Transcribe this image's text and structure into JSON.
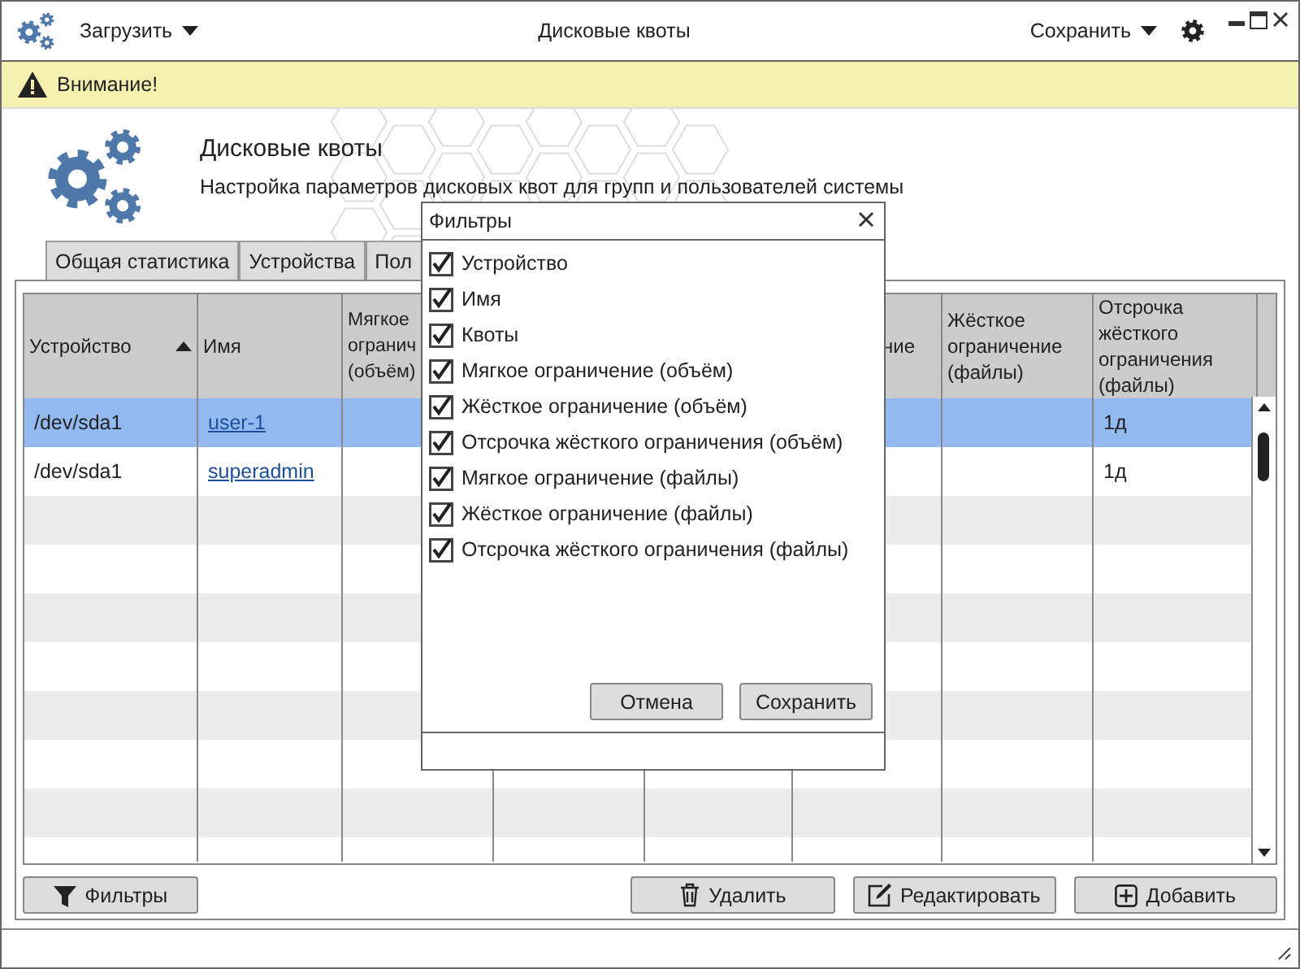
{
  "toolbar": {
    "load_menu": "Загрузить",
    "title": "Дисковые квоты",
    "save_menu": "Сохранить"
  },
  "warning": "Внимание!",
  "header": {
    "title": "Дисковые квоты",
    "subtitle": "Настройка параметров дисковых квот для групп и пользователей системы"
  },
  "tabs": [
    {
      "label": "Общая статистика",
      "selected": false
    },
    {
      "label": "Устройства",
      "selected": false
    },
    {
      "label": "Пол",
      "selected": false
    }
  ],
  "table": {
    "columns": [
      {
        "lines": [
          "Устройство"
        ],
        "sorted": true
      },
      {
        "lines": [
          "Имя"
        ]
      },
      {
        "lines": [
          "Мягкое",
          "огранич",
          "(объём)"
        ]
      },
      {
        "lines": [
          "ние"
        ]
      },
      {
        "lines": [
          "Жёсткое",
          "ограничение",
          "(файлы)"
        ]
      },
      {
        "lines": [
          "Отсрочка",
          "жёсткого",
          "ограничения",
          "(файлы)"
        ]
      }
    ],
    "rows": [
      {
        "device": "/dev/sda1",
        "name": "user-1",
        "grace_files": "1д",
        "selected": true
      },
      {
        "device": "/dev/sda1",
        "name": "superadmin",
        "grace_files": "1д",
        "selected": false
      }
    ]
  },
  "buttons": [
    {
      "label": "Фильтры",
      "kind": "filter"
    },
    {
      "label": "Удалить",
      "kind": "trash"
    },
    {
      "label": "Редактировать",
      "kind": "edit"
    },
    {
      "label": "Добавить",
      "kind": "add"
    }
  ],
  "dialog": {
    "title": "Фильтры",
    "options": [
      {
        "label": "Устройство",
        "checked": true
      },
      {
        "label": "Имя",
        "checked": true
      },
      {
        "label": "Квоты",
        "checked": true
      },
      {
        "label": "Мягкое ограничение (объём)",
        "checked": true
      },
      {
        "label": "Жёсткое ограничение (объём)",
        "checked": true
      },
      {
        "label": "Отсрочка жёсткого ограничения (объём)",
        "checked": true
      },
      {
        "label": "Мягкое ограничение (файлы)",
        "checked": true
      },
      {
        "label": "Жёсткое ограничение (файлы)",
        "checked": true
      },
      {
        "label": "Отсрочка жёсткого ограничения (файлы)",
        "checked": true
      }
    ],
    "buttons": [
      "Отмена",
      "Сохранить"
    ]
  }
}
